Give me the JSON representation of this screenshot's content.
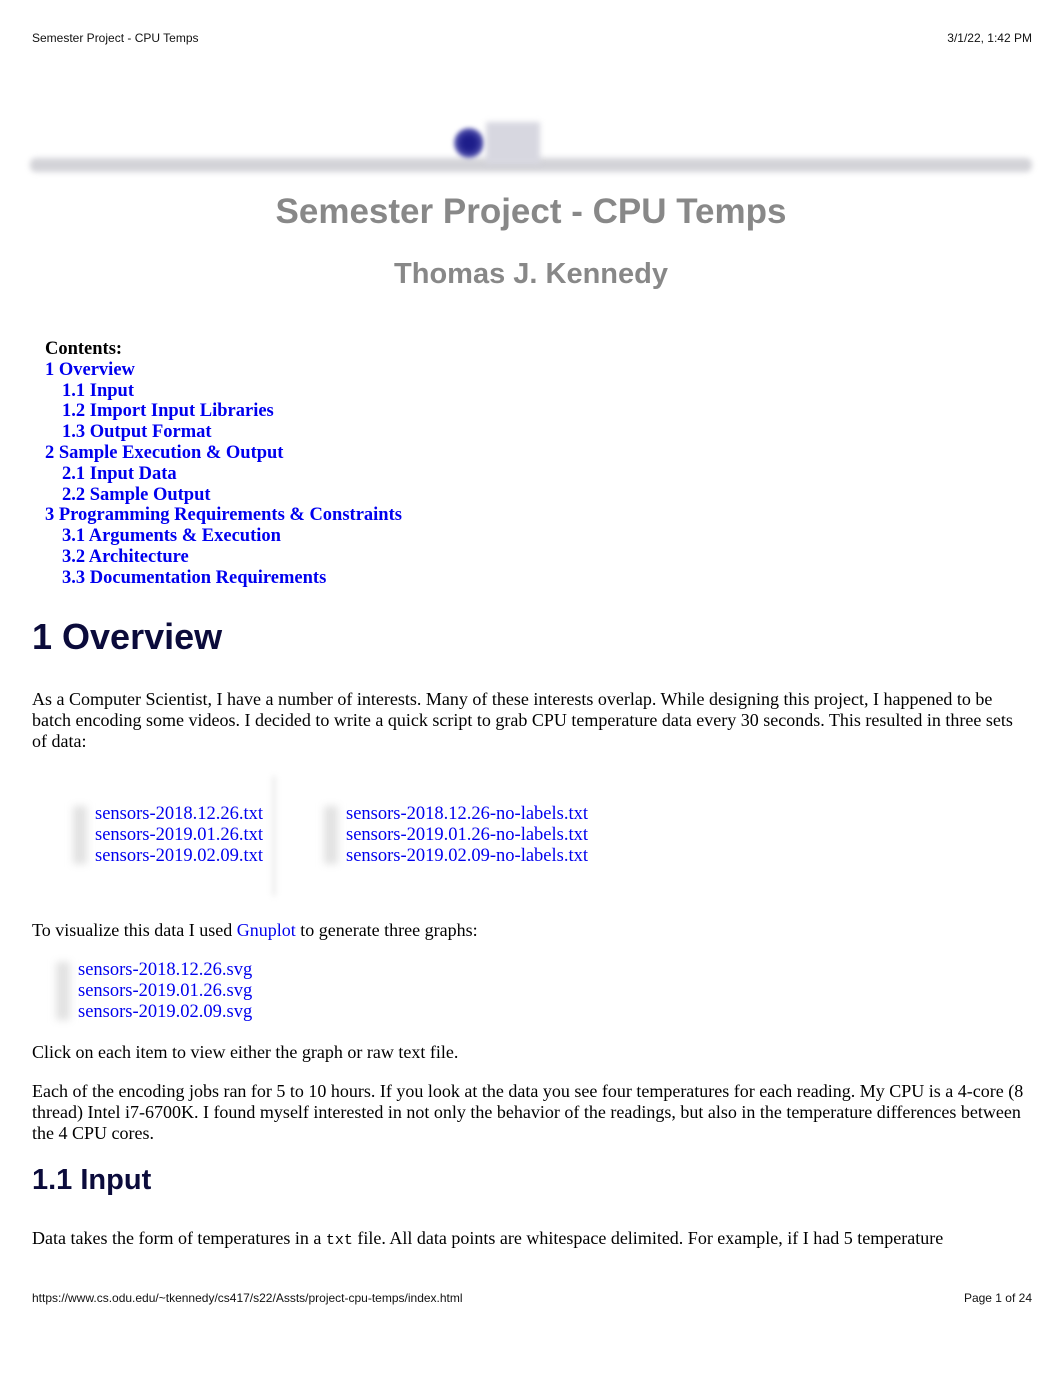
{
  "print_header": {
    "page_title": "Semester Project - CPU Temps",
    "timestamp": "3/1/22, 1:42 PM"
  },
  "print_footer": {
    "url": "https://www.cs.odu.edu/~tkennedy/cs417/s22/Assts/project-cpu-temps/index.html",
    "page_indicator": "Page 1 of 24"
  },
  "document": {
    "title": "Semester Project - CPU Temps",
    "author": "Thomas J. Kennedy",
    "toc": {
      "label": "Contents:",
      "items": [
        {
          "label": "1 Overview",
          "level": 1
        },
        {
          "label": "1.1 Input",
          "level": 2
        },
        {
          "label": "1.2 Import Input Libraries",
          "level": 2
        },
        {
          "label": "1.3 Output Format",
          "level": 2
        },
        {
          "label": "2 Sample Execution & Output",
          "level": 1
        },
        {
          "label": "2.1 Input Data",
          "level": 2
        },
        {
          "label": "2.2 Sample Output",
          "level": 2
        },
        {
          "label": "3 Programming Requirements & Constraints",
          "level": 1
        },
        {
          "label": "3.1 Arguments & Execution",
          "level": 2
        },
        {
          "label": "3.2 Architecture",
          "level": 2
        },
        {
          "label": "3.3 Documentation Requirements",
          "level": 2
        }
      ]
    },
    "overview": {
      "heading": "1 Overview",
      "intro": "As a Computer Scientist, I have a number of interests. Many of these interests overlap. While designing this project, I happened to be batch encoding some videos. I decided to write a quick script to grab CPU temperature data every 30 seconds. This resulted in three sets of data:",
      "data_files": [
        "sensors-2018.12.26.txt",
        "sensors-2019.01.26.txt",
        "sensors-2019.02.09.txt"
      ],
      "data_files_no_labels": [
        "sensors-2018.12.26-no-labels.txt",
        "sensors-2019.01.26-no-labels.txt",
        "sensors-2019.02.09-no-labels.txt"
      ],
      "visualize_before": "To visualize this data I used ",
      "visualize_link": "Gnuplot",
      "visualize_after": " to generate three graphs:",
      "graph_files": [
        "sensors-2018.12.26.svg",
        "sensors-2019.01.26.svg",
        "sensors-2019.02.09.svg"
      ],
      "click_note": "Click on each item to view either the graph or raw text file.",
      "details": "Each of the encoding jobs ran for 5 to 10 hours. If you look at the data you see four temperatures for each reading. My CPU is a 4-core (8 thread) Intel i7-6700K. I found myself interested in not only the behavior of the readings, but also in the temperature differences between the 4 CPU cores."
    },
    "input": {
      "heading": "1.1 Input",
      "text_before": "Data takes the form of temperatures in a ",
      "code": "txt",
      "text_after": " file. All data points are whitespace delimited. For example, if I had 5 temperature"
    }
  }
}
